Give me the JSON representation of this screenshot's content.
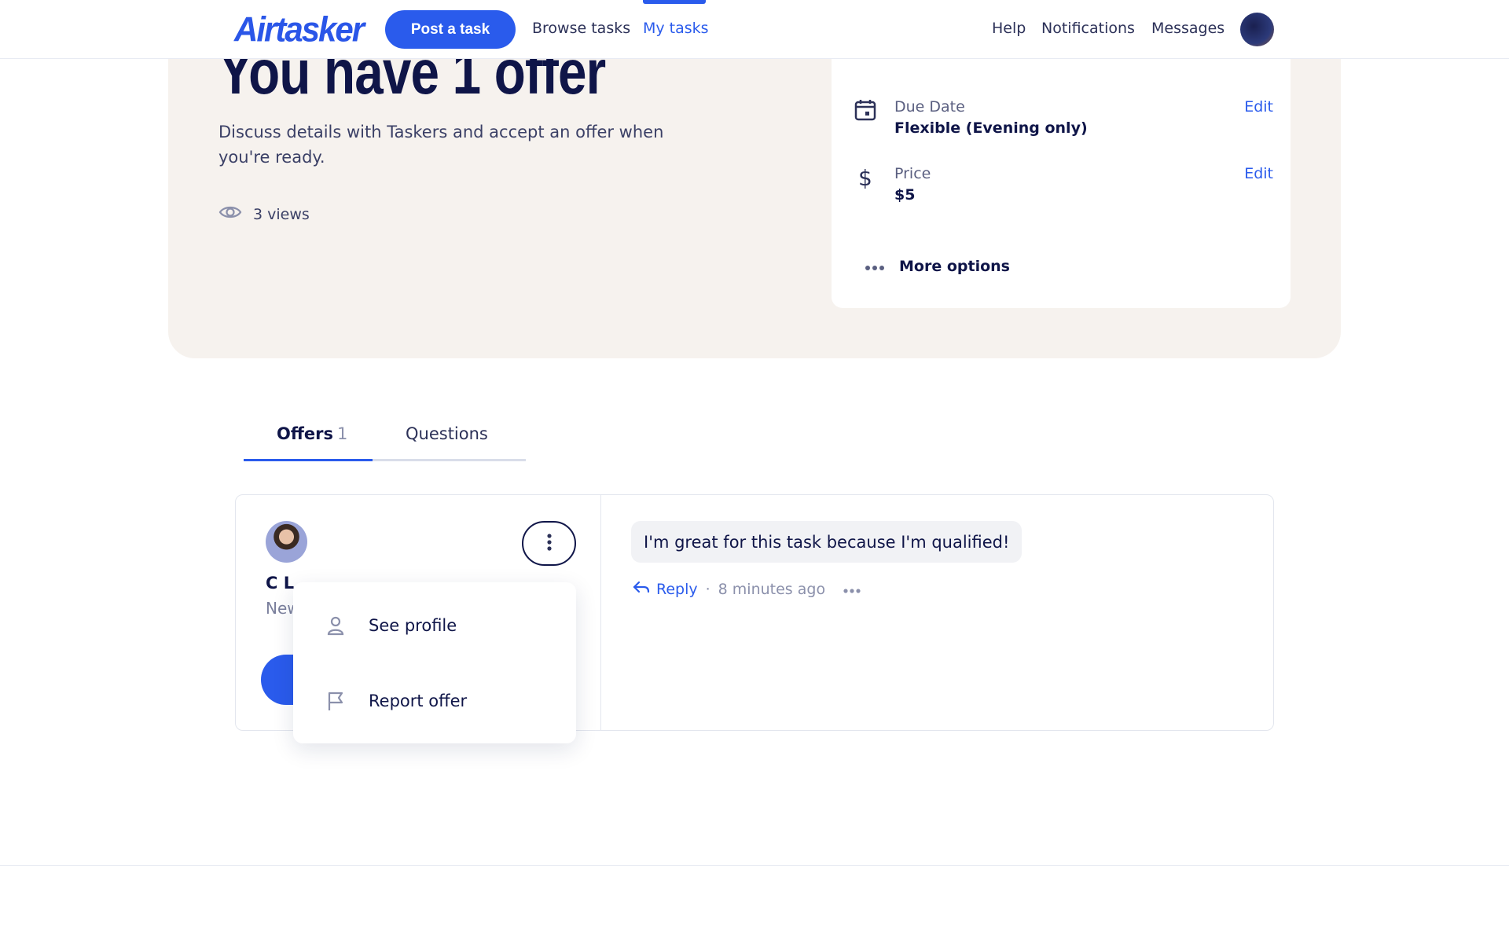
{
  "nav": {
    "logo": "Airtasker",
    "post_task": "Post a task",
    "browse_tasks": "Browse tasks",
    "my_tasks": "My tasks",
    "help": "Help",
    "notifications": "Notifications",
    "messages": "Messages"
  },
  "hero": {
    "title": "You have 1 offer",
    "description": "Discuss details with Taskers and accept an offer when you're ready.",
    "views": "3 views"
  },
  "details": {
    "due_date": {
      "label": "Due Date",
      "value": "Flexible (Evening only)",
      "edit": "Edit"
    },
    "price": {
      "label": "Price",
      "value": "$5",
      "edit": "Edit"
    },
    "more_options": "More options"
  },
  "tabs": {
    "offers_label": "Offers",
    "offers_count": "1",
    "questions_label": "Questions"
  },
  "offer": {
    "tasker_name": "C L.",
    "tasker_sub": "New",
    "menu": {
      "see_profile": "See profile",
      "report_offer": "Report offer"
    },
    "message": "I'm great for this task because I'm qualified!",
    "reply": "Reply",
    "separator": "·",
    "time": "8 minutes ago"
  },
  "colors": {
    "brand": "#2a5bec",
    "navy": "#0f1548",
    "hero_bg": "#f6f2ee"
  }
}
